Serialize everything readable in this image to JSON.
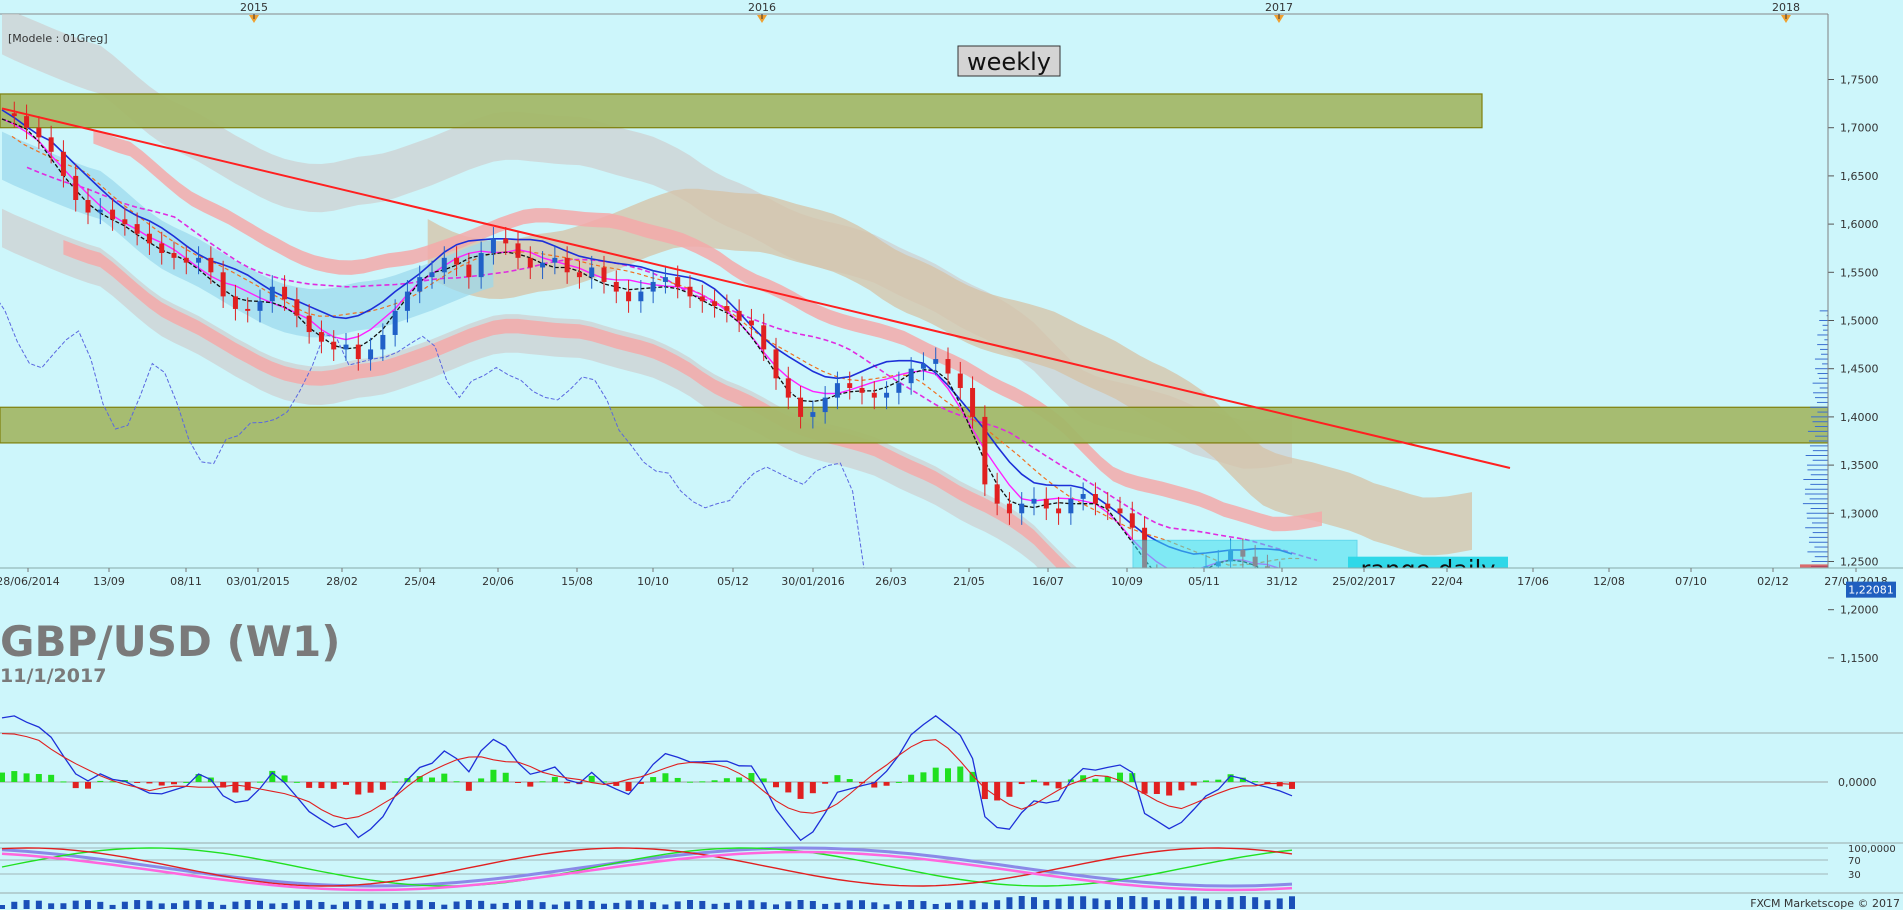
{
  "header": {
    "model_label": "[Modele : 01Greg]",
    "weekly_label": "weekly",
    "range_label": "range daily",
    "symbol": "GBP/USD (W1)",
    "date": "11/1/2017",
    "footer": "FXCM Marketscope © 2017",
    "last_price": "1,22081"
  },
  "chart_data": {
    "type": "candlestick",
    "symbol": "GBP/USD",
    "timeframe": "W1",
    "years": [
      "2015",
      "2016",
      "2017",
      "2018"
    ],
    "x_tick_labels": [
      "28/06/2014",
      "13/09",
      "08/11",
      "03/01/2015",
      "28/02",
      "25/04",
      "20/06",
      "15/08",
      "10/10",
      "05/12",
      "30/01/2016",
      "26/03",
      "21/05",
      "16/07",
      "10/09",
      "05/11",
      "31/12",
      "25/02/2017",
      "22/04",
      "17/06",
      "12/08",
      "07/10",
      "02/12",
      "27/01/2018"
    ],
    "y_ticks": [
      "1,7500",
      "1,7000",
      "1,6500",
      "1,6000",
      "1,5500",
      "1,5000",
      "1,4500",
      "1,4000",
      "1,3500",
      "1,3000",
      "1,2500",
      "1,2000",
      "1,1500"
    ],
    "ylim": [
      1.115,
      1.795
    ],
    "last_price": 1.22081,
    "price_series": [
      [
        1.715,
        "28/06/2014"
      ],
      [
        1.712
      ],
      [
        1.7
      ],
      [
        1.69
      ],
      [
        1.675
      ],
      [
        1.65
      ],
      [
        1.625
      ],
      [
        1.612
      ],
      [
        1.615
      ],
      [
        1.605
      ],
      [
        1.6
      ],
      [
        1.59
      ],
      [
        1.58
      ],
      [
        1.57
      ],
      [
        1.565
      ],
      [
        1.56
      ],
      [
        1.565
      ],
      [
        1.55
      ],
      [
        1.525
      ],
      [
        1.512
      ],
      [
        1.51
      ],
      [
        1.52
      ],
      [
        1.535
      ],
      [
        1.522
      ],
      [
        1.505
      ],
      [
        1.488
      ],
      [
        1.478
      ],
      [
        1.47
      ],
      [
        1.475
      ],
      [
        1.46
      ],
      [
        1.47
      ],
      [
        1.485
      ],
      [
        1.51
      ],
      [
        1.53
      ],
      [
        1.545
      ],
      [
        1.55
      ],
      [
        1.565
      ],
      [
        1.558
      ],
      [
        1.545
      ],
      [
        1.57
      ],
      [
        1.585
      ],
      [
        1.58
      ],
      [
        1.565
      ],
      [
        1.555
      ],
      [
        1.56
      ],
      [
        1.565
      ],
      [
        1.55
      ],
      [
        1.545
      ],
      [
        1.555
      ],
      [
        1.54
      ],
      [
        1.53
      ],
      [
        1.52
      ],
      [
        1.53
      ],
      [
        1.54
      ],
      [
        1.545
      ],
      [
        1.535
      ],
      [
        1.525
      ],
      [
        1.52
      ],
      [
        1.515
      ],
      [
        1.51
      ],
      [
        1.5
      ],
      [
        1.495
      ],
      [
        1.47
      ],
      [
        1.44
      ],
      [
        1.42
      ],
      [
        1.4
      ],
      [
        1.405
      ],
      [
        1.42
      ],
      [
        1.435
      ],
      [
        1.43
      ],
      [
        1.425
      ],
      [
        1.42
      ],
      [
        1.425
      ],
      [
        1.435
      ],
      [
        1.45
      ],
      [
        1.455
      ],
      [
        1.46
      ],
      [
        1.445
      ],
      [
        1.43
      ],
      [
        1.4
      ],
      [
        1.33
      ],
      [
        1.31
      ],
      [
        1.3
      ],
      [
        1.31
      ],
      [
        1.315
      ],
      [
        1.305
      ],
      [
        1.3
      ],
      [
        1.315
      ],
      [
        1.32
      ],
      [
        1.31
      ],
      [
        1.305
      ],
      [
        1.3
      ],
      [
        1.285
      ],
      [
        1.235
      ],
      [
        1.225
      ],
      [
        1.215
      ],
      [
        1.22
      ],
      [
        1.232
      ],
      [
        1.245
      ],
      [
        1.25
      ],
      [
        1.262
      ],
      [
        1.255
      ],
      [
        1.245
      ],
      [
        1.238
      ],
      [
        1.23
      ],
      [
        1.221
      ]
    ],
    "zones": [
      {
        "name": "resistance",
        "y": [
          1.7,
          1.735
        ],
        "until": "22/04"
      },
      {
        "name": "support",
        "y": [
          1.373,
          1.41
        ]
      }
    ],
    "trendline": {
      "from": [
        1.72,
        "28/06/2014"
      ],
      "to": [
        1.347,
        "17/06"
      ]
    },
    "range_box": {
      "y": [
        1.21,
        1.272
      ],
      "label": "range daily"
    },
    "macd_axis": [
      "0,0000"
    ],
    "stoch_axis": [
      "100,0000",
      "70",
      "30"
    ]
  },
  "colors": {
    "background": "#cdf6fb",
    "bull": "#2060c8",
    "bear": "#e02020",
    "zone": "#a4b96a",
    "zone_border": "#7a7a00",
    "trend": "#ff2020",
    "cloud_red": "#f3a9a9",
    "cloud_grey": "#cfcfcf",
    "cloud_tan": "#d6c2a6",
    "range_box": "#40e0f0"
  }
}
